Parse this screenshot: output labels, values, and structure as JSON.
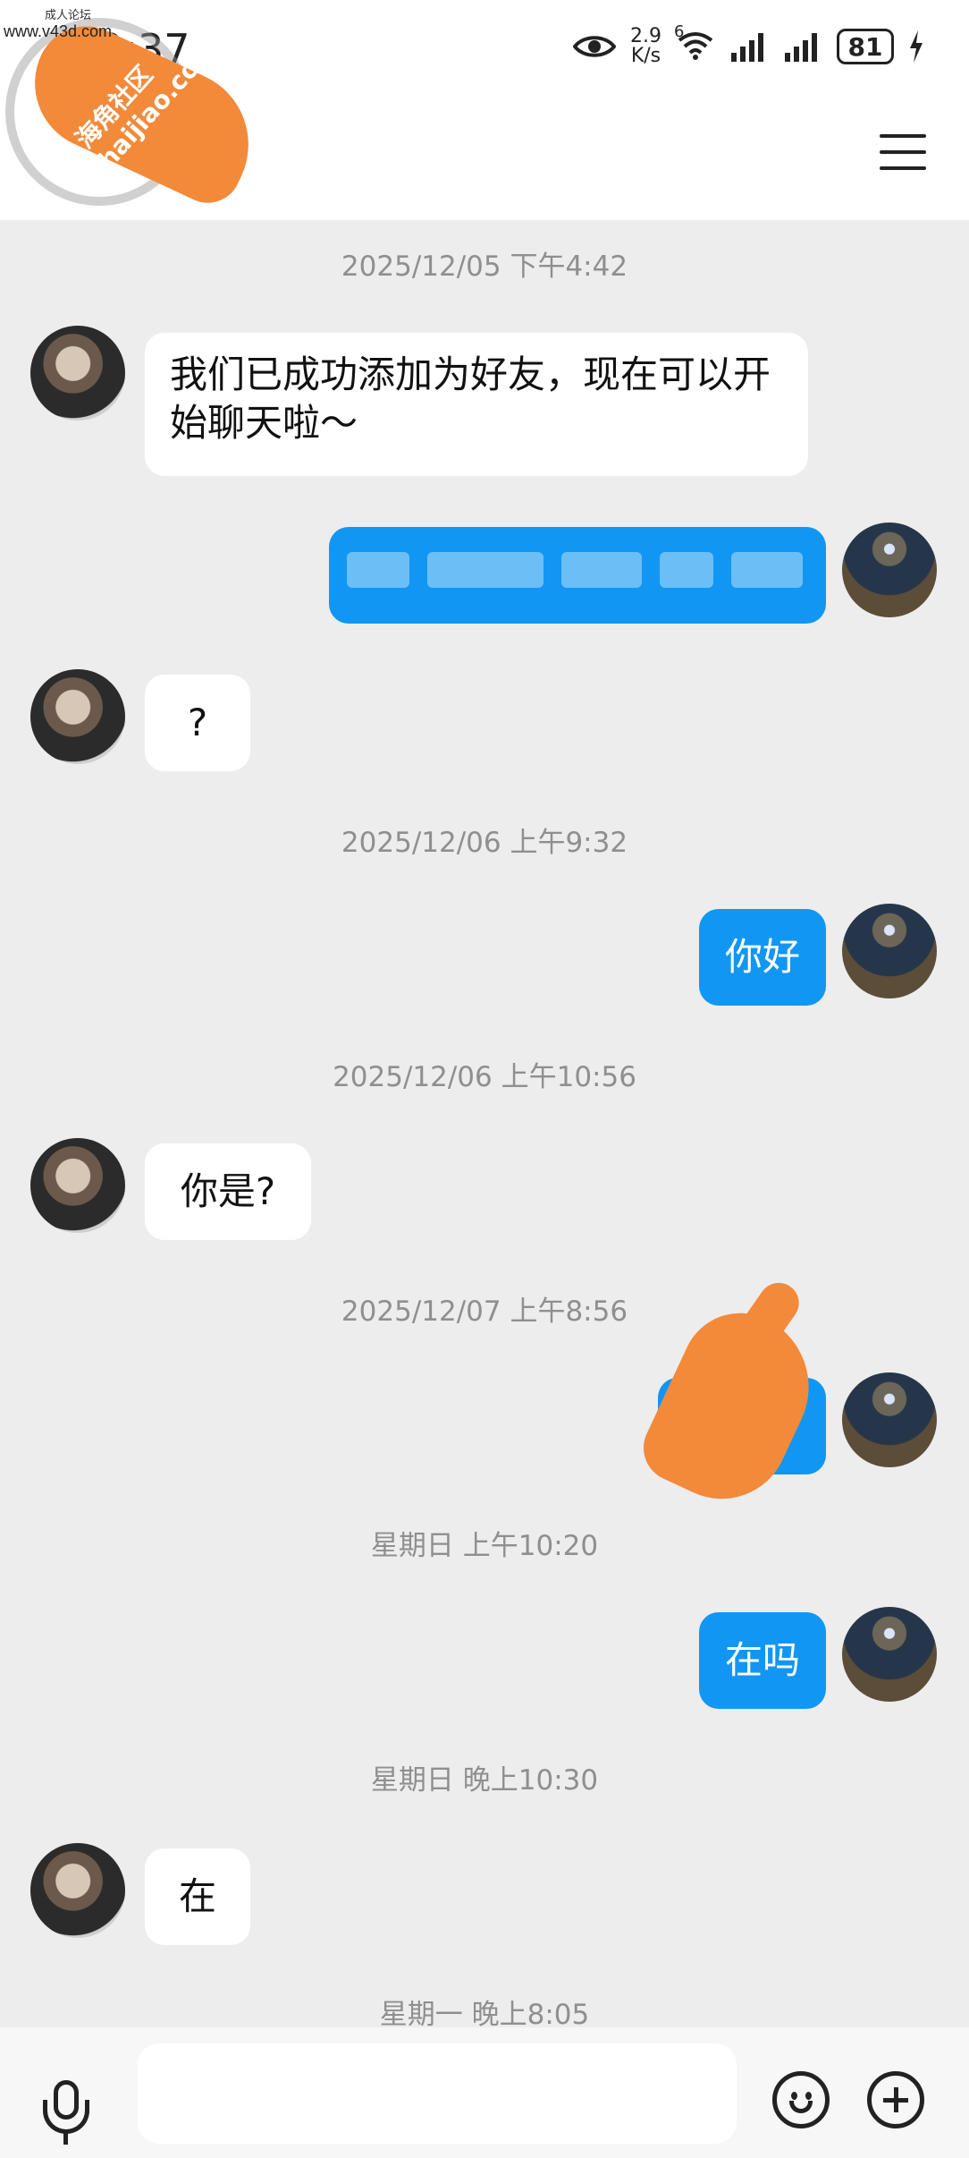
{
  "status_bar": {
    "time": "10:37",
    "net_speed_value": "2.9",
    "net_speed_unit": "K/s",
    "wifi_label": "6",
    "battery": "81"
  },
  "watermark": {
    "small_text": "成人论坛",
    "site": "www.v43d.com",
    "brand_line1": "海角社区",
    "brand_line2": "haijiao.com"
  },
  "chat": {
    "timestamps": [
      "2025/12/05 下午4:42",
      "2025/12/06 上午9:32",
      "2025/12/06 上午10:56",
      "2025/12/07 上午8:56",
      "星期日 上午10:20",
      "星期日 晚上10:30",
      "星期一 晚上8:05"
    ],
    "messages": [
      {
        "side": "left",
        "text": "我们已成功添加为好友，现在可以开始聊天啦～"
      },
      {
        "side": "right",
        "text": ""
      },
      {
        "side": "left",
        "text": "?"
      },
      {
        "side": "right",
        "text": "你好"
      },
      {
        "side": "left",
        "text": "你是?"
      },
      {
        "side": "right",
        "text": ""
      },
      {
        "side": "right",
        "text": "在吗"
      },
      {
        "side": "left",
        "text": "在"
      }
    ]
  },
  "input_bar": {
    "placeholder": ""
  }
}
